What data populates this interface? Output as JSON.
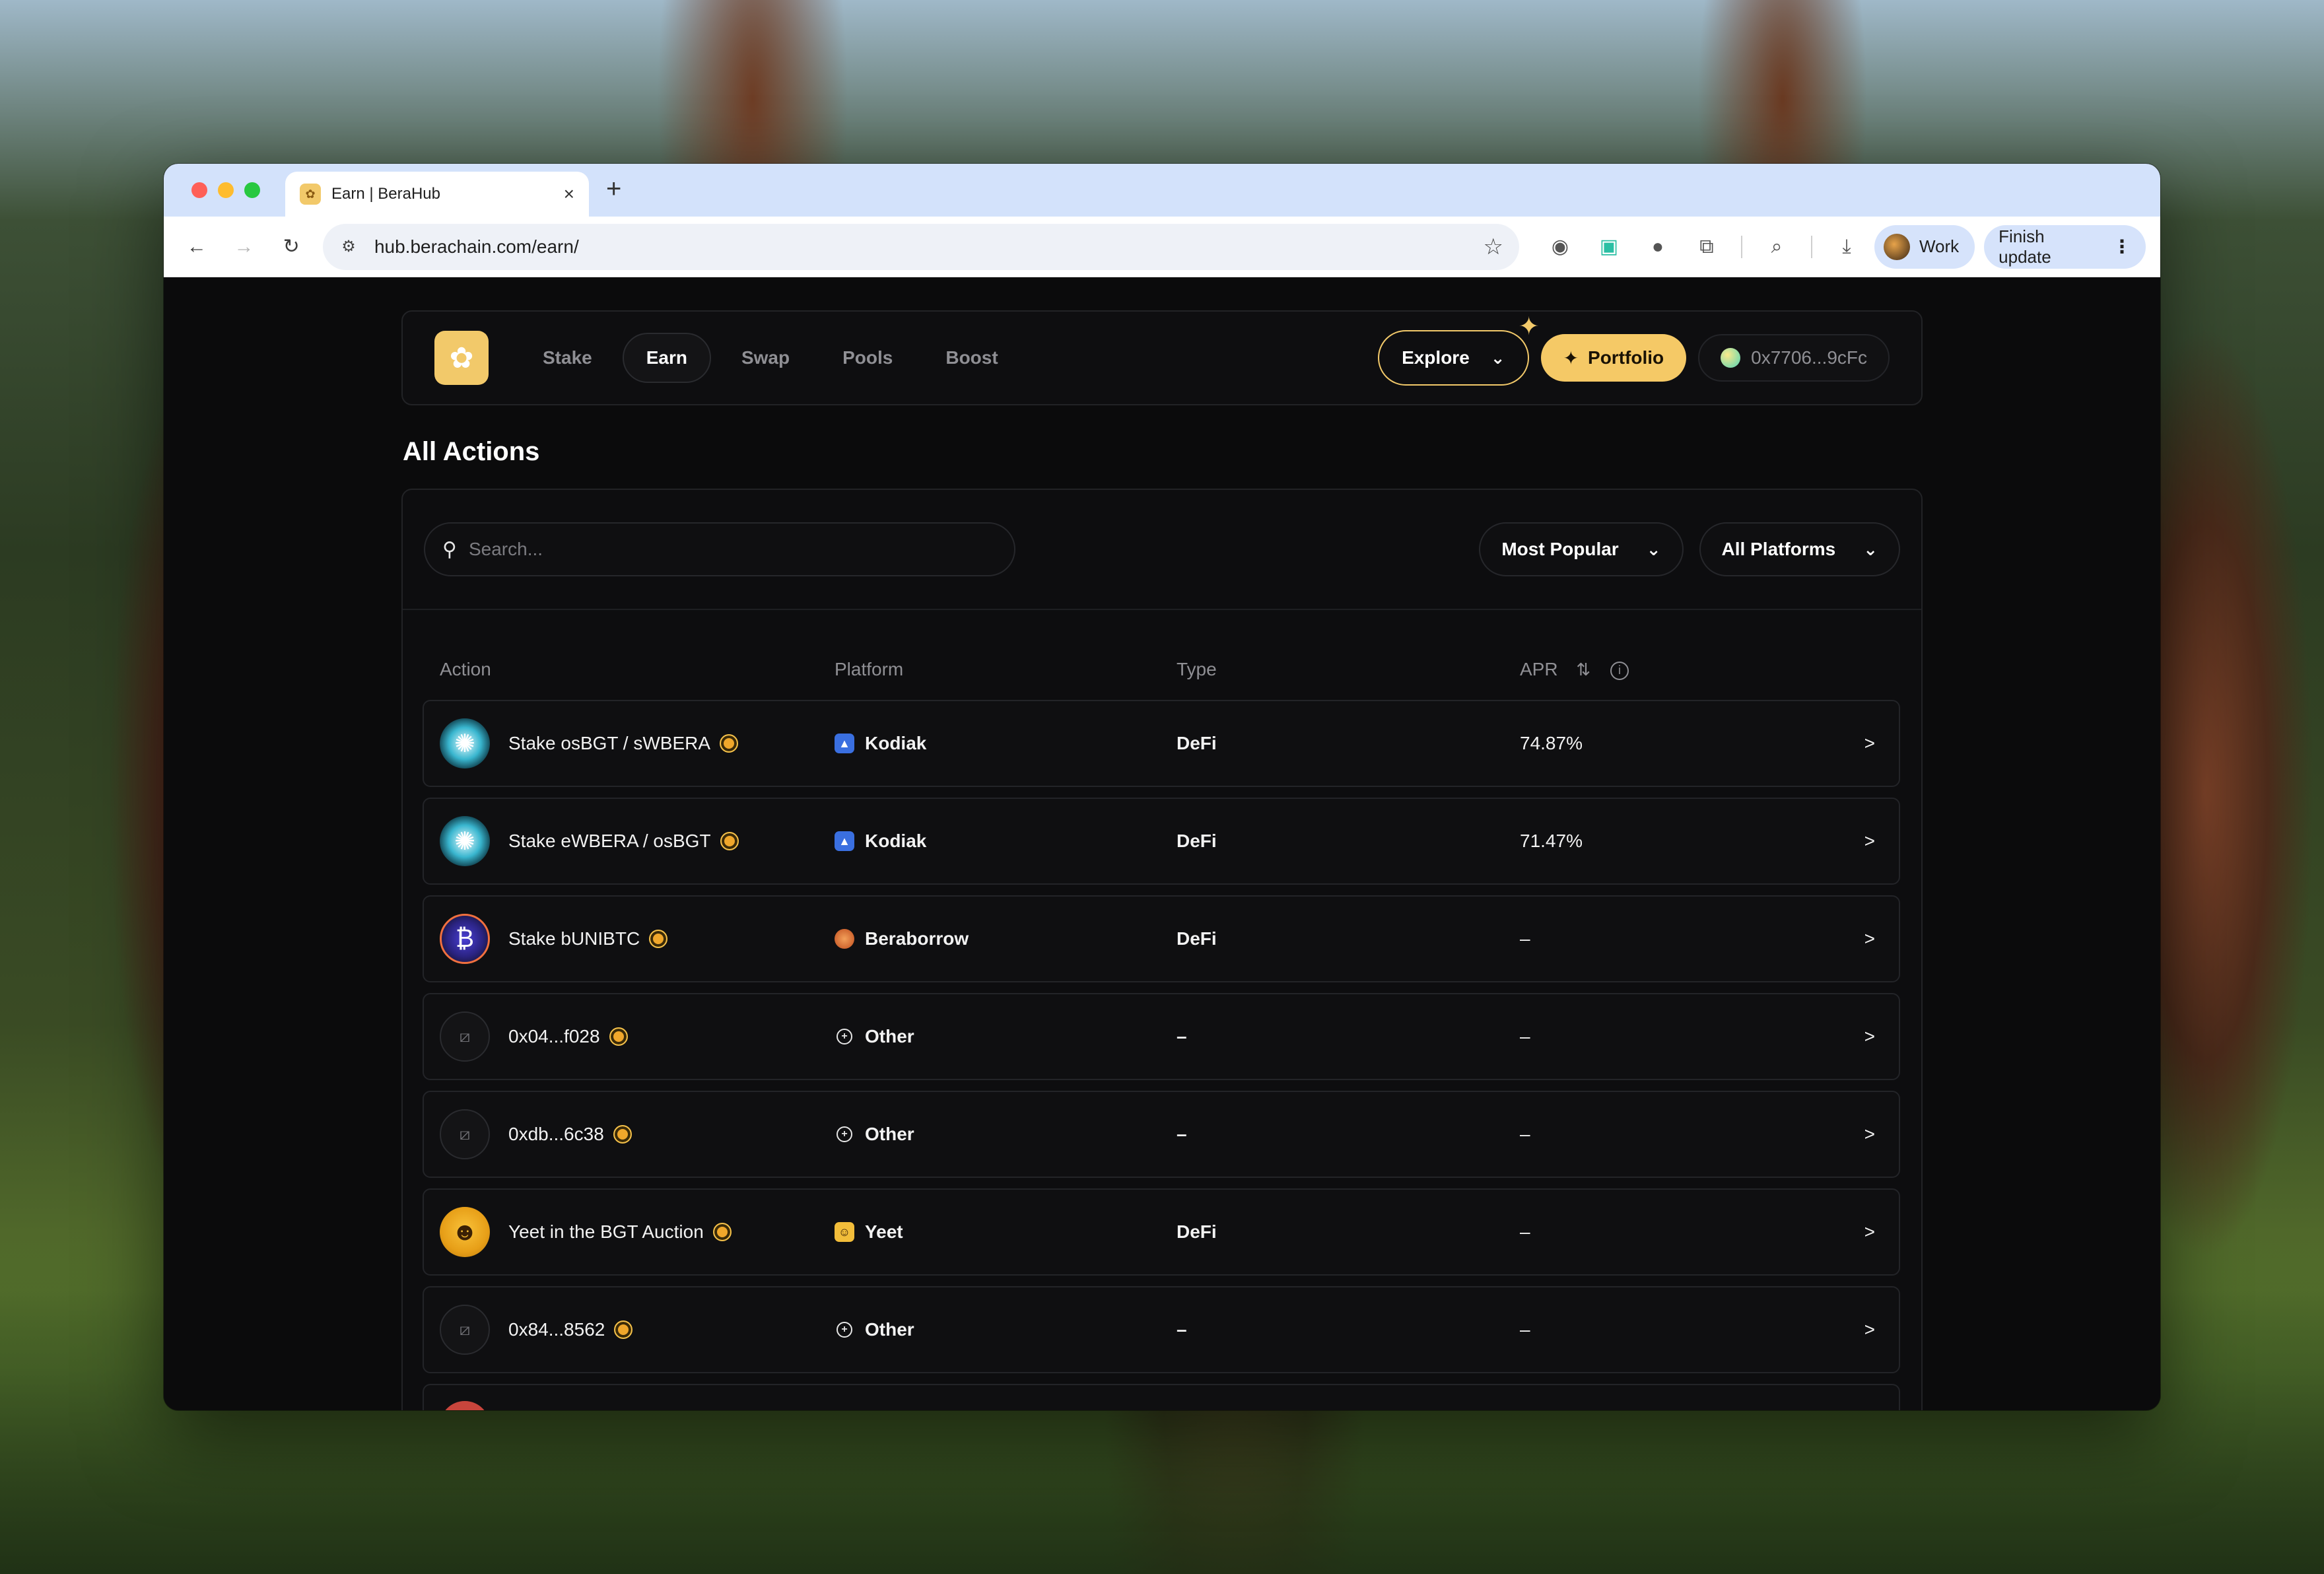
{
  "browser": {
    "tab_title": "Earn | BeraHub",
    "new_tab": "+",
    "url": "hub.berachain.com/earn/",
    "profile_label": "Work",
    "update_label": "Finish update"
  },
  "app_nav": {
    "links": [
      "Stake",
      "Earn",
      "Swap",
      "Pools",
      "Boost"
    ],
    "active": "Earn",
    "explore_label": "Explore",
    "portfolio_label": "Portfolio",
    "wallet_label": "0x7706...9cFc"
  },
  "page_title": "All Actions",
  "filters": {
    "search_placeholder": "Search...",
    "sort_label": "Most Popular",
    "platform_label": "All Platforms"
  },
  "table": {
    "headers": {
      "action": "Action",
      "platform": "Platform",
      "type": "Type",
      "apr": "APR"
    },
    "rows": [
      {
        "action": "Stake osBGT / sWBERA",
        "icon": "swirl-icon",
        "platform": "Kodiak",
        "platform_icon": "kodiak-icon",
        "type": "DeFi",
        "apr": "74.87%",
        "go": ">"
      },
      {
        "action": "Stake eWBERA / osBGT",
        "icon": "swirl-icon",
        "platform": "Kodiak",
        "platform_icon": "kodiak-icon",
        "type": "DeFi",
        "apr": "71.47%",
        "go": ">"
      },
      {
        "action": "Stake bUNIBTC",
        "icon": "bunibtc-icon",
        "platform": "Beraborrow",
        "platform_icon": "beraborrow-icon",
        "type": "DeFi",
        "apr": "–",
        "go": ">"
      },
      {
        "action": "0x04...f028",
        "icon": "contract-icon",
        "platform": "Other",
        "platform_icon": "other-icon",
        "type": "–",
        "apr": "–",
        "go": ">"
      },
      {
        "action": "0xdb...6c38",
        "icon": "contract-icon",
        "platform": "Other",
        "platform_icon": "other-icon",
        "type": "–",
        "apr": "–",
        "go": ">"
      },
      {
        "action": "Yeet in the BGT Auction",
        "icon": "yeet-icon",
        "platform": "Yeet",
        "platform_icon": "yeet-icon",
        "type": "DeFi",
        "apr": "–",
        "go": ">"
      },
      {
        "action": "0x84...8562",
        "icon": "contract-icon",
        "platform": "Other",
        "platform_icon": "other-icon",
        "type": "–",
        "apr": "–",
        "go": ">"
      }
    ]
  },
  "colors": {
    "accent": "#f5c966",
    "apr_positive": "#4fa8ff",
    "page_bg": "#0b0b0c"
  }
}
